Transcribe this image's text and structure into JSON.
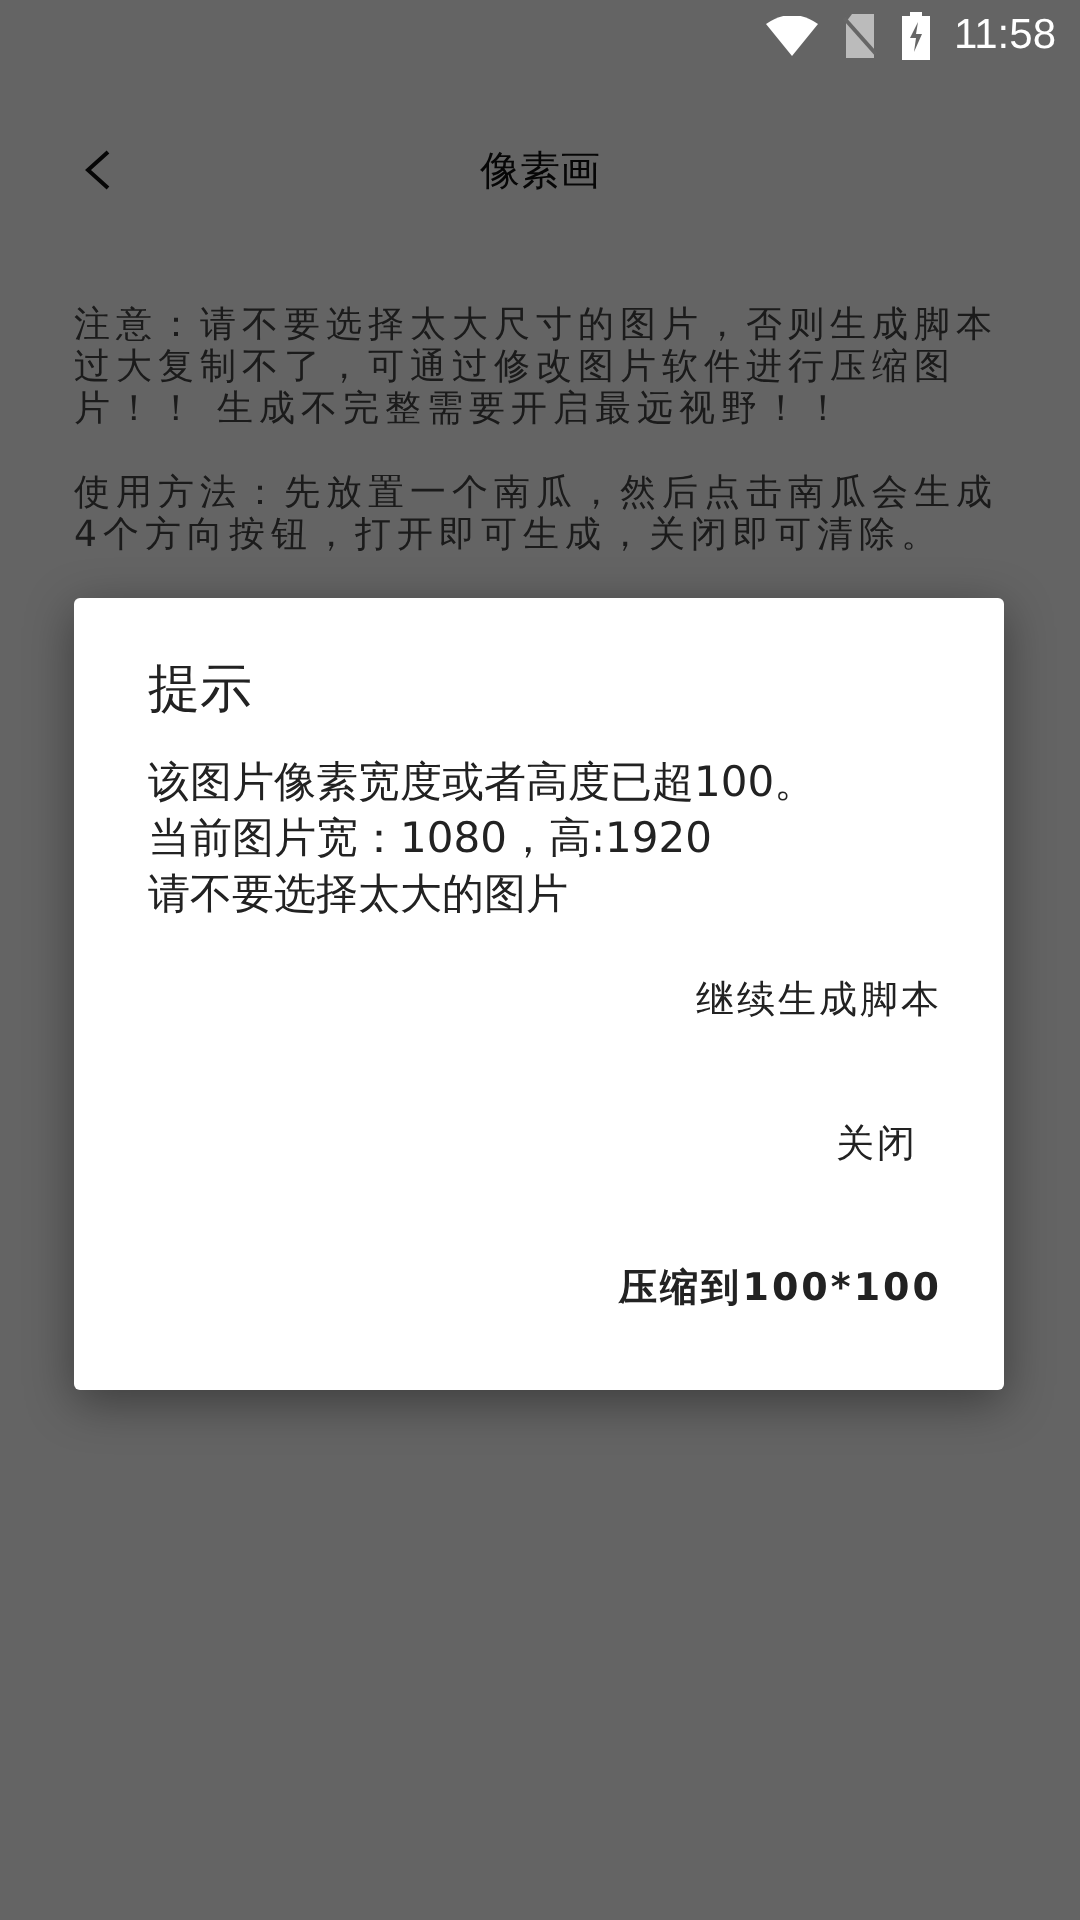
{
  "status_bar": {
    "time": "11:58"
  },
  "app_bar": {
    "title": "像素画"
  },
  "notes": [
    "注意：请不要选择太大尺寸的图片，否则生成脚本过大复制不了，可通过修改图片软件进行压缩图片！！ 生成不完整需要开启最远视野！！",
    "使用方法：先放置一个南瓜，然后点击南瓜会生成4个方向按钮，打开即可生成，关闭即可清除。"
  ],
  "dialog": {
    "title": "提示",
    "message_lines": [
      "该图片像素宽度或者高度已超100。",
      "当前图片宽：1080，高:1920",
      "请不要选择太大的图片"
    ],
    "buttons": [
      "继续生成脚本",
      "关闭",
      "压缩到100*100"
    ]
  }
}
